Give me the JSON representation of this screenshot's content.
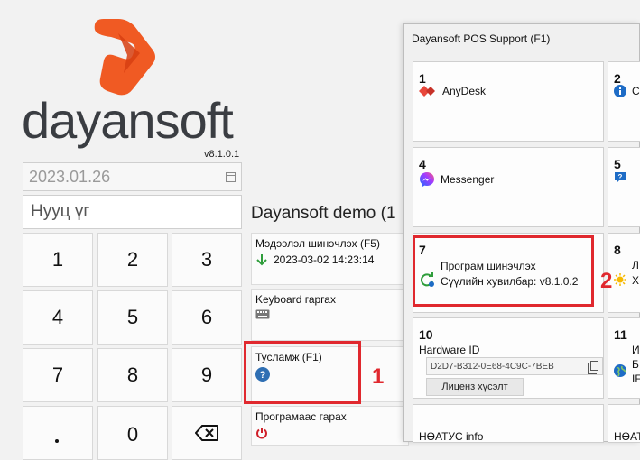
{
  "app": {
    "brand_name": "dayansoft",
    "version": "v8.1.0.1",
    "colors": {
      "brand_orange": "#f05a23",
      "accent_red": "#e0282e"
    }
  },
  "login": {
    "date_value": "2023.01.26",
    "password_placeholder": "Нууц үг",
    "keypad": [
      "1",
      "2",
      "3",
      "4",
      "5",
      "6",
      "7",
      "8",
      "9",
      "",
      "0",
      ""
    ],
    "backspace_icon": "backspace-icon"
  },
  "company": {
    "name": "Dayansoft demo (1"
  },
  "actions": {
    "update_data": {
      "label": "Мэдээлэл шинэчлэх (F5)",
      "timestamp": "2023-03-02 14:23:14"
    },
    "keyboard": {
      "label": "Keyboard гаргах"
    },
    "help": {
      "label": "Тусламж (F1)"
    },
    "exit": {
      "label": "Програмаас гарах"
    }
  },
  "annotations": {
    "first": "1",
    "second": "2"
  },
  "support_dialog": {
    "title": "Dayansoft POS Support (F1)",
    "tiles": [
      {
        "num": "1",
        "label": "AnyDesk"
      },
      {
        "num": "2",
        "label": "С"
      },
      {
        "num": "4",
        "label": "Messenger"
      },
      {
        "num": "5",
        "label": ""
      },
      {
        "num": "7",
        "label": "Програм шинэчлэх",
        "sub": "Сүүлийн хувилбар: v8.1.0.2"
      },
      {
        "num": "8",
        "label": "Л",
        "sub": "Х"
      },
      {
        "num": "10",
        "label": "Hardware ID",
        "hw_id": "D2D7-B312-0E68-4C9C-7BEB",
        "button": "Лиценз хүсэлт"
      },
      {
        "num": "11",
        "label": "И",
        "sub": "Б",
        "sub2": "IF"
      },
      {
        "label": "НӨАТУС info"
      },
      {
        "label": "НӨАТ"
      }
    ]
  }
}
